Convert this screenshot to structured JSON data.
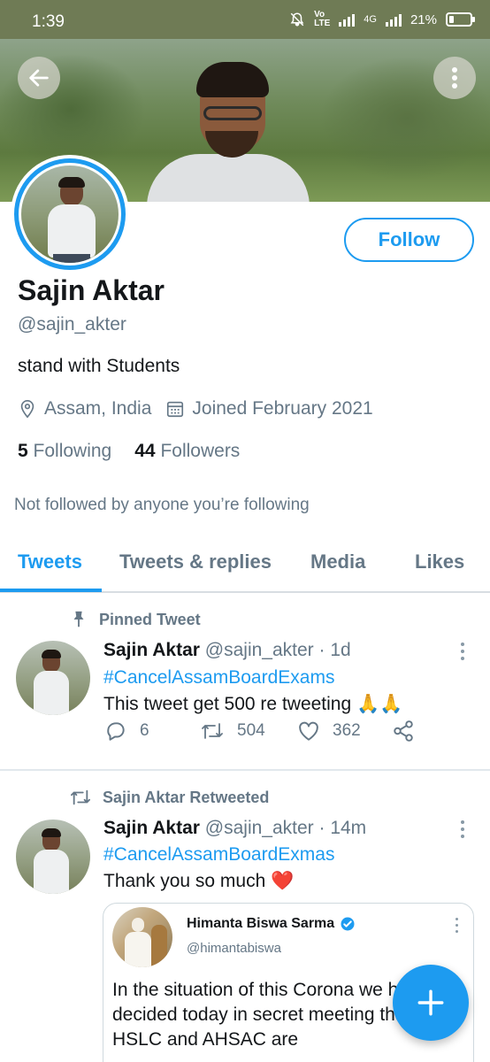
{
  "status_bar": {
    "time": "1:39",
    "network_label": "4G",
    "battery": "21%"
  },
  "profile": {
    "follow_label": "Follow",
    "name": "Sajin Aktar",
    "handle": "@sajin_akter",
    "bio": "stand with Students",
    "location": "Assam, India",
    "joined": "Joined February 2021",
    "following_count": "5",
    "following_label": "Following",
    "followers_count": "44",
    "followers_label": "Followers",
    "not_followed_note": "Not followed by anyone you’re following"
  },
  "tabs": [
    {
      "label": "Tweets",
      "active": true
    },
    {
      "label": "Tweets & replies",
      "active": false
    },
    {
      "label": "Media",
      "active": false
    },
    {
      "label": "Likes",
      "active": false
    }
  ],
  "tweets": [
    {
      "context": "Pinned Tweet",
      "author": "Sajin Aktar",
      "meta": "@sajin_akter · 1d",
      "hashtag": "#CancelAssamBoardExams",
      "text": "This tweet get 500 re tweeting 🙏🙏",
      "replies": "6",
      "retweets": "504",
      "likes": "362"
    },
    {
      "context": "Sajin Aktar Retweeted",
      "author": "Sajin Aktar",
      "meta": "@sajin_akter · 14m",
      "hashtag": "#CancelAssamBoardExmas",
      "text": "Thank you so much ❤️",
      "quote": {
        "name": "Himanta Biswa Sarma",
        "handle": "@himantabiswa",
        "text": "In the situation of this Corona we have decided today in secret meeting that HSLC and AHSAC are"
      }
    }
  ],
  "colors": {
    "accent": "#1d9bf0",
    "secondary_text": "#657786",
    "primary_text": "#14171a",
    "status_bar": "#6f7b55"
  },
  "icons": [
    "back-arrow-icon",
    "more-vert-icon",
    "location-pin-icon",
    "calendar-icon",
    "pin-icon",
    "retweet-icon",
    "reply-icon",
    "like-icon",
    "share-icon",
    "verified-icon",
    "compose-plus-icon"
  ]
}
